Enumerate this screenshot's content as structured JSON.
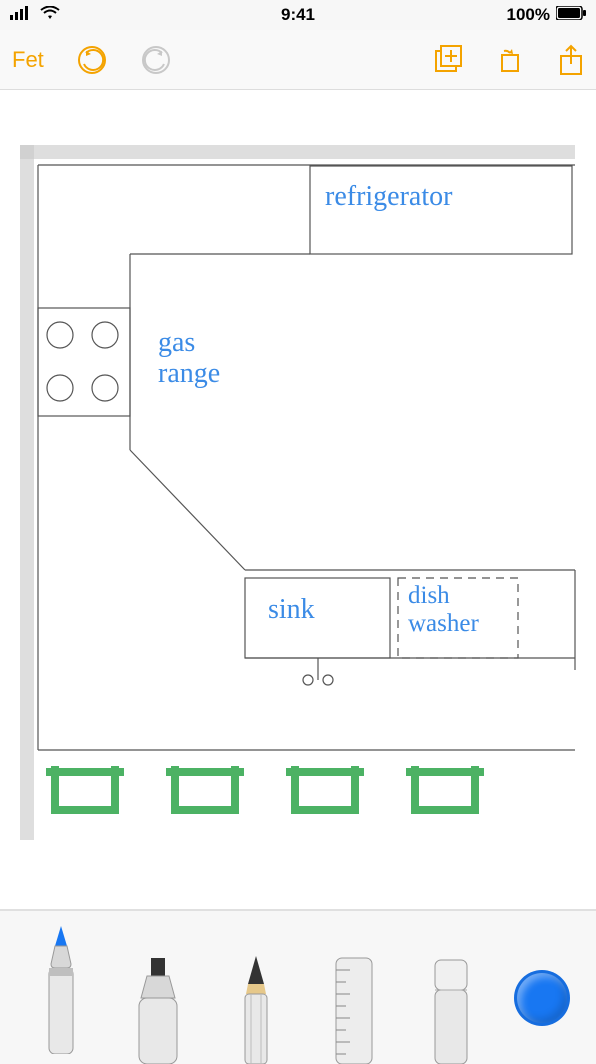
{
  "status": {
    "time": "9:41",
    "battery": "100%"
  },
  "toolbar": {
    "done": "Fet"
  },
  "sketch": {
    "labels": {
      "refrigerator": "refrigerator",
      "gas_range": "gas\nrange",
      "sink": "sink",
      "dish_washer": "dish\nwasher"
    }
  },
  "tools": {
    "pen": "pen-tool",
    "marker": "marker-tool",
    "pencil": "pencil-tool",
    "ruler": "ruler-tool",
    "eraser": "eraser-tool",
    "color": "#1877f2"
  }
}
